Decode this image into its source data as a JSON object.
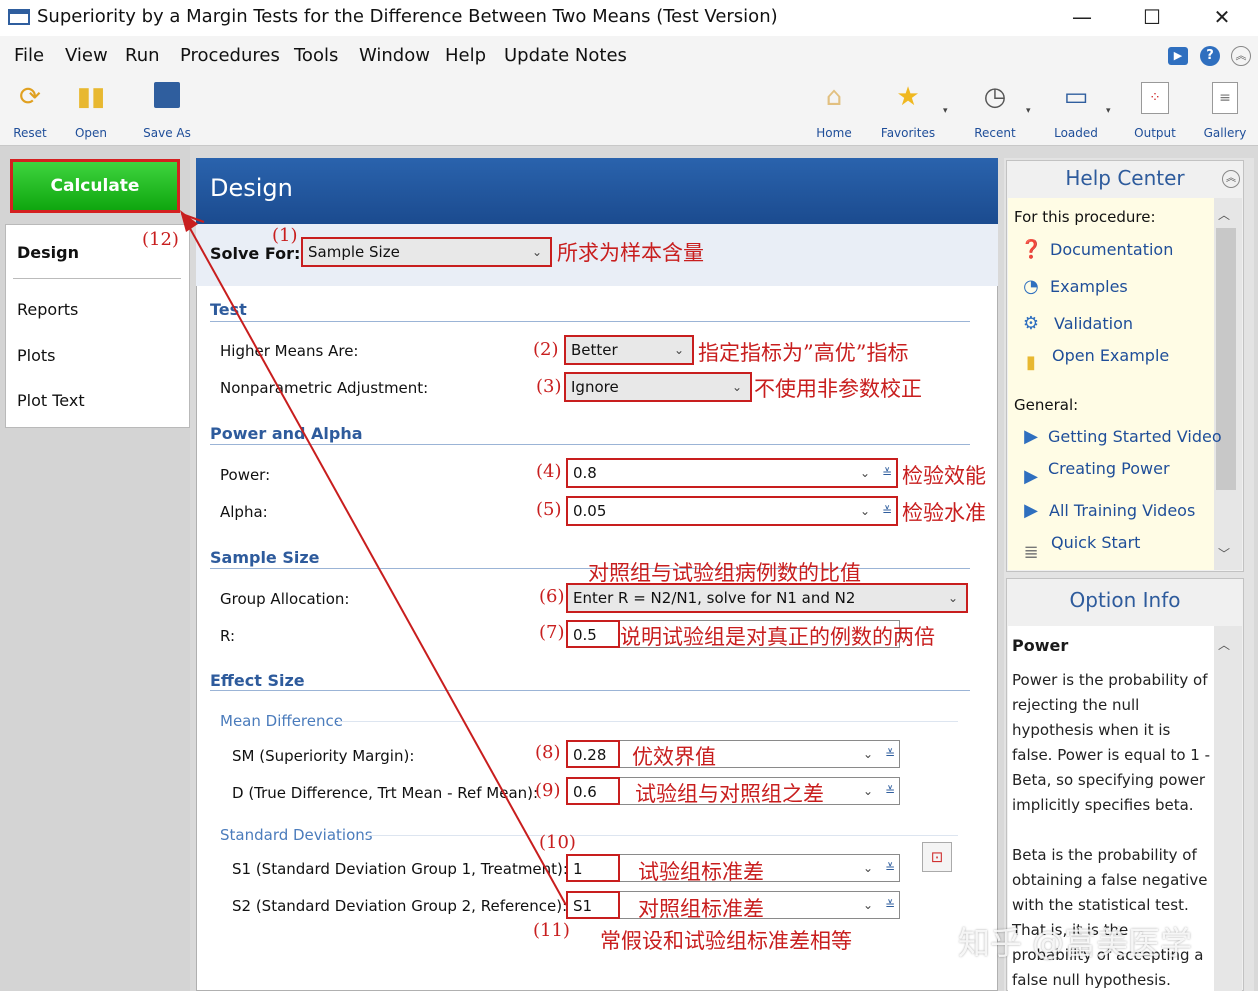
{
  "window": {
    "title": "Superiority by a Margin Tests for the Difference Between Two Means (Test Version)",
    "min": "—",
    "max": "☐",
    "close": "✕"
  },
  "menu": [
    "File",
    "View",
    "Run",
    "Procedures",
    "Tools",
    "Window",
    "Help",
    "Update Notes"
  ],
  "toolbar": {
    "left": [
      {
        "label": "Reset",
        "icon": "refresh-icon"
      },
      {
        "label": "Open",
        "icon": "folder-open-icon"
      },
      {
        "label": "Save As",
        "icon": "floppy-disk-icon"
      }
    ],
    "right": [
      {
        "label": "Home",
        "icon": "home-icon"
      },
      {
        "label": "Favorites",
        "icon": "star-icon"
      },
      {
        "label": "Recent",
        "icon": "clock-icon"
      },
      {
        "label": "Loaded",
        "icon": "windows-icon"
      },
      {
        "label": "Output",
        "icon": "output-icon"
      },
      {
        "label": "Gallery",
        "icon": "gallery-icon"
      }
    ]
  },
  "left_nav": {
    "calculate": "Calculate",
    "items": [
      "Design",
      "Reports",
      "Plots",
      "Plot Text"
    ]
  },
  "design": {
    "title": "Design",
    "solve_for_label": "Solve For:",
    "solve_for_value": "Sample Size",
    "sections": {
      "test": "Test",
      "power_alpha": "Power and Alpha",
      "sample_size": "Sample Size",
      "effect_size": "Effect Size",
      "mean_difference": "Mean Difference",
      "standard_deviations": "Standard Deviations"
    },
    "fields": {
      "higher_means_label": "Higher Means Are:",
      "higher_means_value": "Better",
      "nonparam_label": "Nonparametric Adjustment:",
      "nonparam_value": "Ignore",
      "power_label": "Power:",
      "power_value": "0.8",
      "alpha_label": "Alpha:",
      "alpha_value": "0.05",
      "group_alloc_label": "Group Allocation:",
      "group_alloc_value": "Enter R = N2/N1, solve for N1 and N2",
      "r_label": "R:",
      "r_value": "0.5",
      "sm_label": "SM (Superiority Margin):",
      "sm_value": "0.28",
      "d_label": "D (True Difference, Trt Mean - Ref Mean):",
      "d_value": "0.6",
      "s1_label": "S1 (Standard Deviation Group 1, Treatment):",
      "s1_value": "1",
      "s2_label": "S2 (Standard Deviation Group 2, Reference):",
      "s2_value": "S1"
    }
  },
  "annotations": {
    "n1": "(1)",
    "a1": "所求为样本含量",
    "n2": "(2)",
    "a2": "指定指标为”高优”指标",
    "n3": "(3)",
    "a3": "不使用非参数校正",
    "n4": "(4)",
    "a4": "检验效能",
    "n5": "(5)",
    "a5": "检验水准",
    "n6": "(6)",
    "a6": "对照组与试验组病例数的比值",
    "n7": "(7)",
    "a7": "说明试验组是对真正的例数的两倍",
    "n8": "(8)",
    "a8": "优效界值",
    "n9": "(9)",
    "a9": "试验组与对照组之差",
    "n10": "(10)",
    "a10": "试验组标准差",
    "n11": "(11)",
    "a11": "对照组标准差",
    "a12": "常假设和试验组标准差相等",
    "n12": "(12)"
  },
  "help_center": {
    "title": "Help Center",
    "for_this": "For this procedure:",
    "links_proc": [
      "Documentation",
      "Examples",
      "Validation",
      "Open Example"
    ],
    "general": "General:",
    "links_general": [
      "Getting Started Video",
      "Creating Power",
      "All Training Videos",
      "Quick Start"
    ]
  },
  "option_info": {
    "title": "Option Info",
    "heading": "Power",
    "p1": "Power is the probability of rejecting the null hypothesis when it is false. Power is equal to 1 - Beta, so specifying power implicitly specifies beta.",
    "p2": "Beta is the probability of obtaining a false negative with the statistical test. That is, it is the probability of accepting a false null hypothesis."
  },
  "watermark": "知乎 @富美医学",
  "colors": {
    "accent": "#2e5b9c",
    "annotation": "#c81e1e",
    "calculate": "#12a812"
  }
}
